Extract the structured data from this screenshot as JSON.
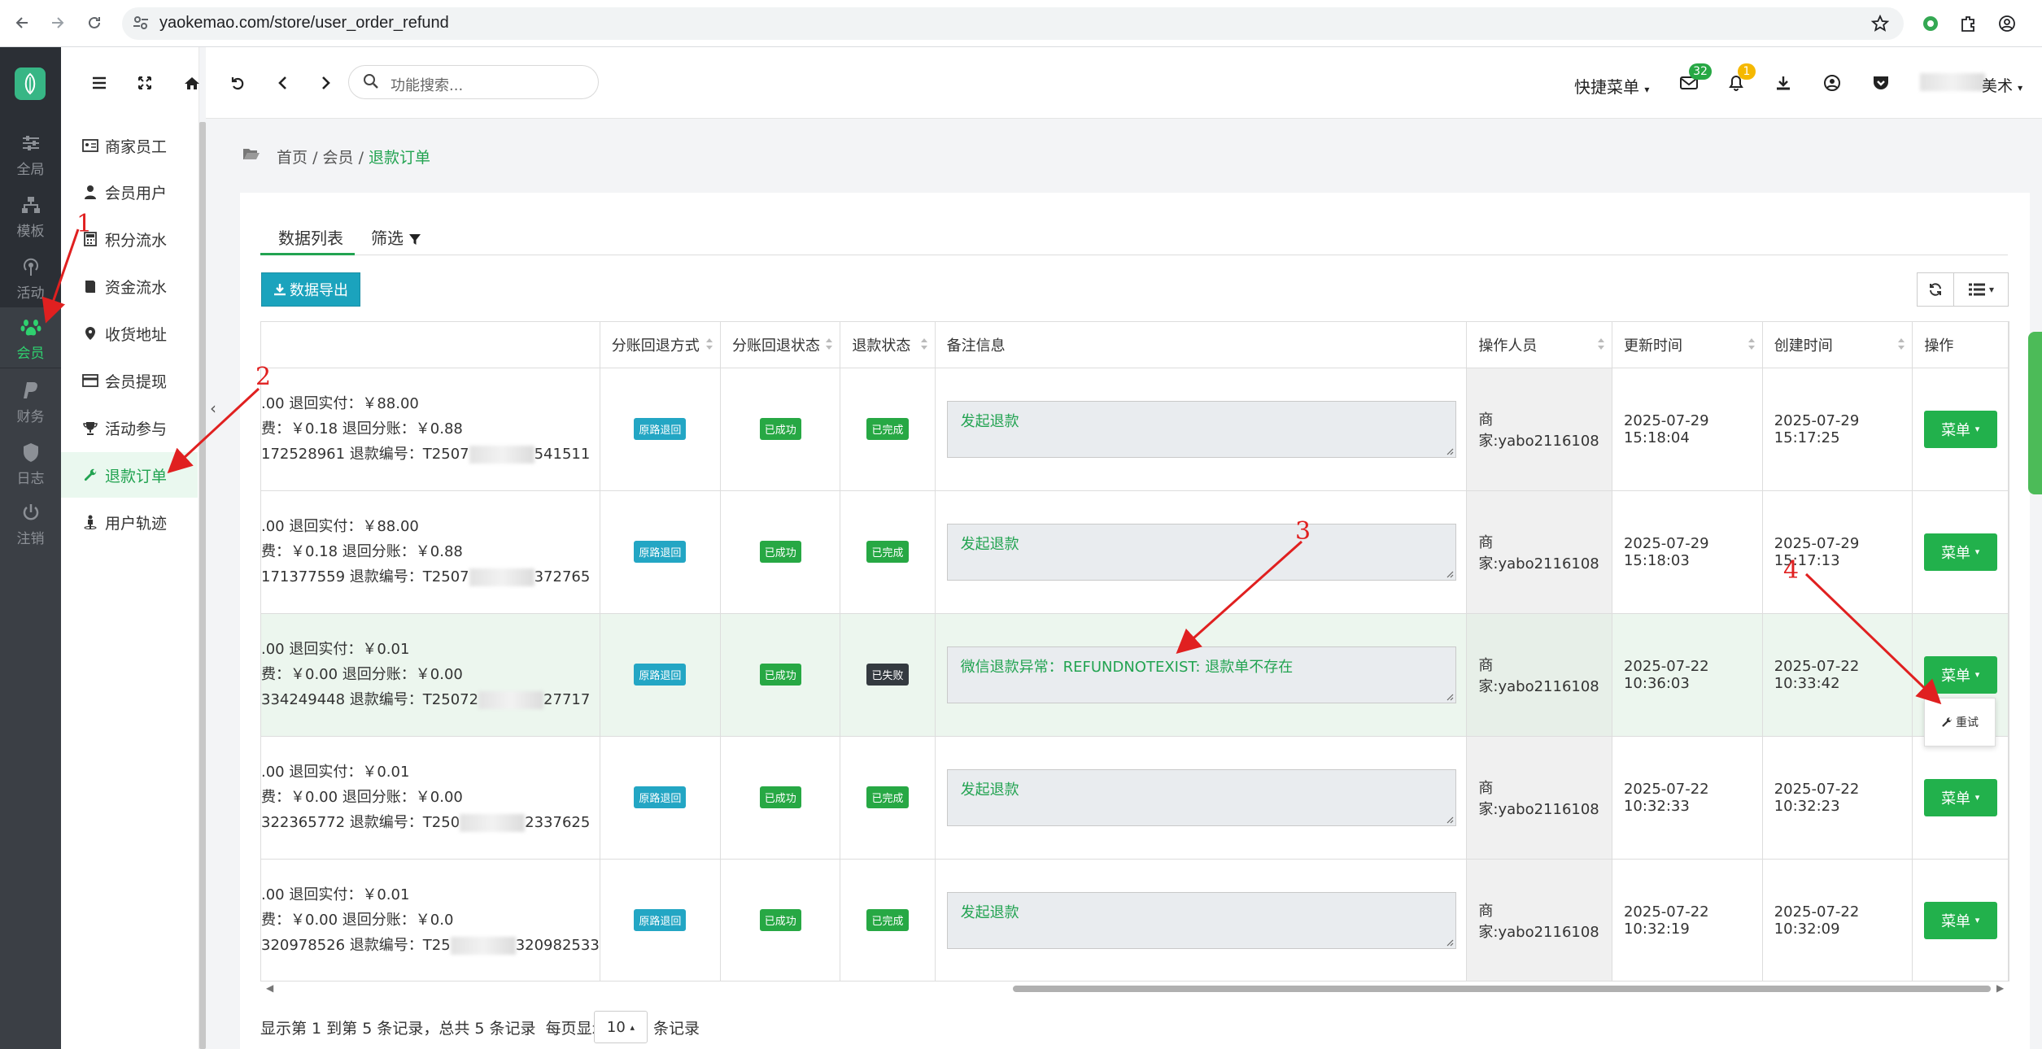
{
  "browser": {
    "url": "yaokemao.com/store/user_order_refund"
  },
  "rail": {
    "items": [
      {
        "label": "全局",
        "icon": "sliders-icon"
      },
      {
        "label": "模板",
        "icon": "sitemap-icon"
      },
      {
        "label": "活动",
        "icon": "broadcast-icon"
      },
      {
        "label": "会员",
        "icon": "paw-icon",
        "active": true
      },
      {
        "label": "财务",
        "icon": "paypal-icon"
      },
      {
        "label": "日志",
        "icon": "shield-icon"
      },
      {
        "label": "注销",
        "icon": "power-icon"
      }
    ]
  },
  "sidebar": {
    "items": [
      {
        "label": "商家员工",
        "icon": "id-card-icon"
      },
      {
        "label": "会员用户",
        "icon": "user-icon"
      },
      {
        "label": "积分流水",
        "icon": "calculator-icon"
      },
      {
        "label": "资金流水",
        "icon": "book-icon"
      },
      {
        "label": "收货地址",
        "icon": "map-marker-icon"
      },
      {
        "label": "会员提现",
        "icon": "credit-card-icon"
      },
      {
        "label": "活动参与",
        "icon": "trophy-icon"
      },
      {
        "label": "退款订单",
        "icon": "wrench-icon",
        "active": true
      },
      {
        "label": "用户轨迹",
        "icon": "street-view-icon"
      }
    ]
  },
  "header": {
    "search_placeholder": "功能搜索...",
    "quick_menu": "快捷菜单",
    "mail_badge": "32",
    "bell_badge": "1",
    "username_suffix": "美术"
  },
  "breadcrumb": {
    "home": "首页",
    "sep": "/",
    "parent": "会员",
    "current": "退款订单"
  },
  "tabs": {
    "list": "数据列表",
    "filter": "筛选"
  },
  "toolbar": {
    "export": "数据导出"
  },
  "table": {
    "columns": [
      "分账回退方式",
      "分账回退状态",
      "退款状态",
      "备注信息",
      "操作人员",
      "更新时间",
      "创建时间",
      "操作"
    ],
    "rows": [
      {
        "line1": ".00 退回实付：￥88.00",
        "line2a": "费：￥0.18 退回分账：￥0.88",
        "line3a": "172528961 退款编号：T2507",
        "line3b": "541511",
        "method": "原路退回",
        "split_status": "已成功",
        "refund_status": "已完成",
        "remark": "发起退款",
        "operator": "商家:yabo2116108",
        "updated": "2025-07-29 15:18:04",
        "created": "2025-07-29 15:17:25",
        "action": "菜单"
      },
      {
        "line1": ".00 退回实付：￥88.00",
        "line2a": "费：￥0.18 退回分账：￥0.88",
        "line3a": "171377559 退款编号：T2507",
        "line3b": "372765",
        "method": "原路退回",
        "split_status": "已成功",
        "refund_status": "已完成",
        "remark": "发起退款",
        "operator": "商家:yabo2116108",
        "updated": "2025-07-29 15:18:03",
        "created": "2025-07-29 15:17:13",
        "action": "菜单"
      },
      {
        "line1": ".00 退回实付：￥0.01",
        "line2a": "费：￥0.00 退回分账：￥0.00",
        "line3a": "334249448 退款编号：T25072",
        "line3b": "27717",
        "method": "原路退回",
        "split_status": "已成功",
        "refund_status": "已失败",
        "remark": "微信退款异常：REFUNDNOTEXIST: 退款单不存在",
        "operator": "商家:yabo2116108",
        "updated": "2025-07-22 10:36:03",
        "created": "2025-07-22 10:33:42",
        "action": "菜单"
      },
      {
        "line1": ".00 退回实付：￥0.01",
        "line2a": "费：￥0.00 退回分账：￥0.00",
        "line3a": "322365772 退款编号：T250",
        "line3b": "2337625",
        "method": "原路退回",
        "split_status": "已成功",
        "refund_status": "已完成",
        "remark": "发起退款",
        "operator": "商家:yabo2116108",
        "updated": "2025-07-22 10:32:33",
        "created": "2025-07-22 10:32:23",
        "action": "菜单"
      },
      {
        "line1": ".00 退回实付：￥0.01",
        "line2a": "费：￥0.00 退回分账：￥0.0",
        "line3a": "320978526 退款编号：T25",
        "line3b": "320982533",
        "method": "原路退回",
        "split_status": "已成功",
        "refund_status": "已完成",
        "remark": "发起退款",
        "operator": "商家:yabo2116108",
        "updated": "2025-07-22 10:32:19",
        "created": "2025-07-22 10:32:09",
        "action": "菜单"
      }
    ],
    "dropdown_item": "重试"
  },
  "pager": {
    "summary": "显示第 1 到第 5 条记录，总共 5 条记录",
    "per_page_label": "每页显示",
    "page_size": "10",
    "records_suffix": "条记录"
  },
  "annotations": [
    "1",
    "2",
    "3",
    "4"
  ],
  "colors": {
    "accent": "#22a351",
    "menu_button": "#22b14c",
    "export_button": "#1ba3bd",
    "annotation": "#e02020"
  }
}
